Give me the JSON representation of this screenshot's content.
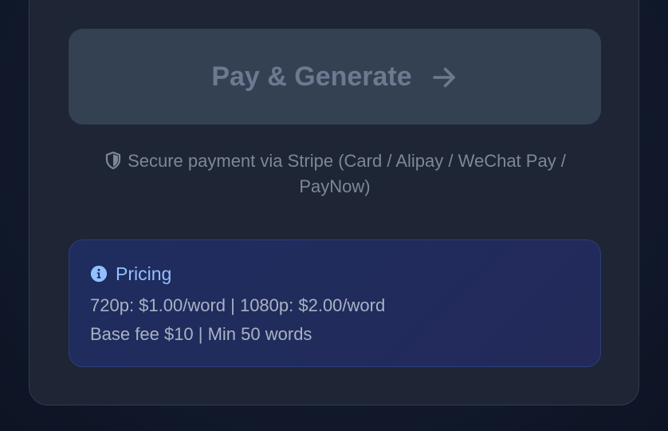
{
  "payment": {
    "button_label": "Pay & Generate",
    "button_icon": "arrow-right-icon",
    "secure_icon": "shield-icon",
    "secure_text": "Secure payment via Stripe (Card / Alipay / WeChat Pay / PayNow)"
  },
  "pricing": {
    "icon": "info-icon",
    "title": "Pricing",
    "line1": "720p: $1.00/word | 1080p: $2.00/word",
    "line2": "Base fee $10 | Min 50 words"
  },
  "colors": {
    "background": "#111827",
    "card": "#1e2535",
    "button_disabled": "#344152",
    "button_text": "#6b7a90",
    "pricing_bg": "#1e2d5e",
    "pricing_accent": "#93c0ff"
  }
}
